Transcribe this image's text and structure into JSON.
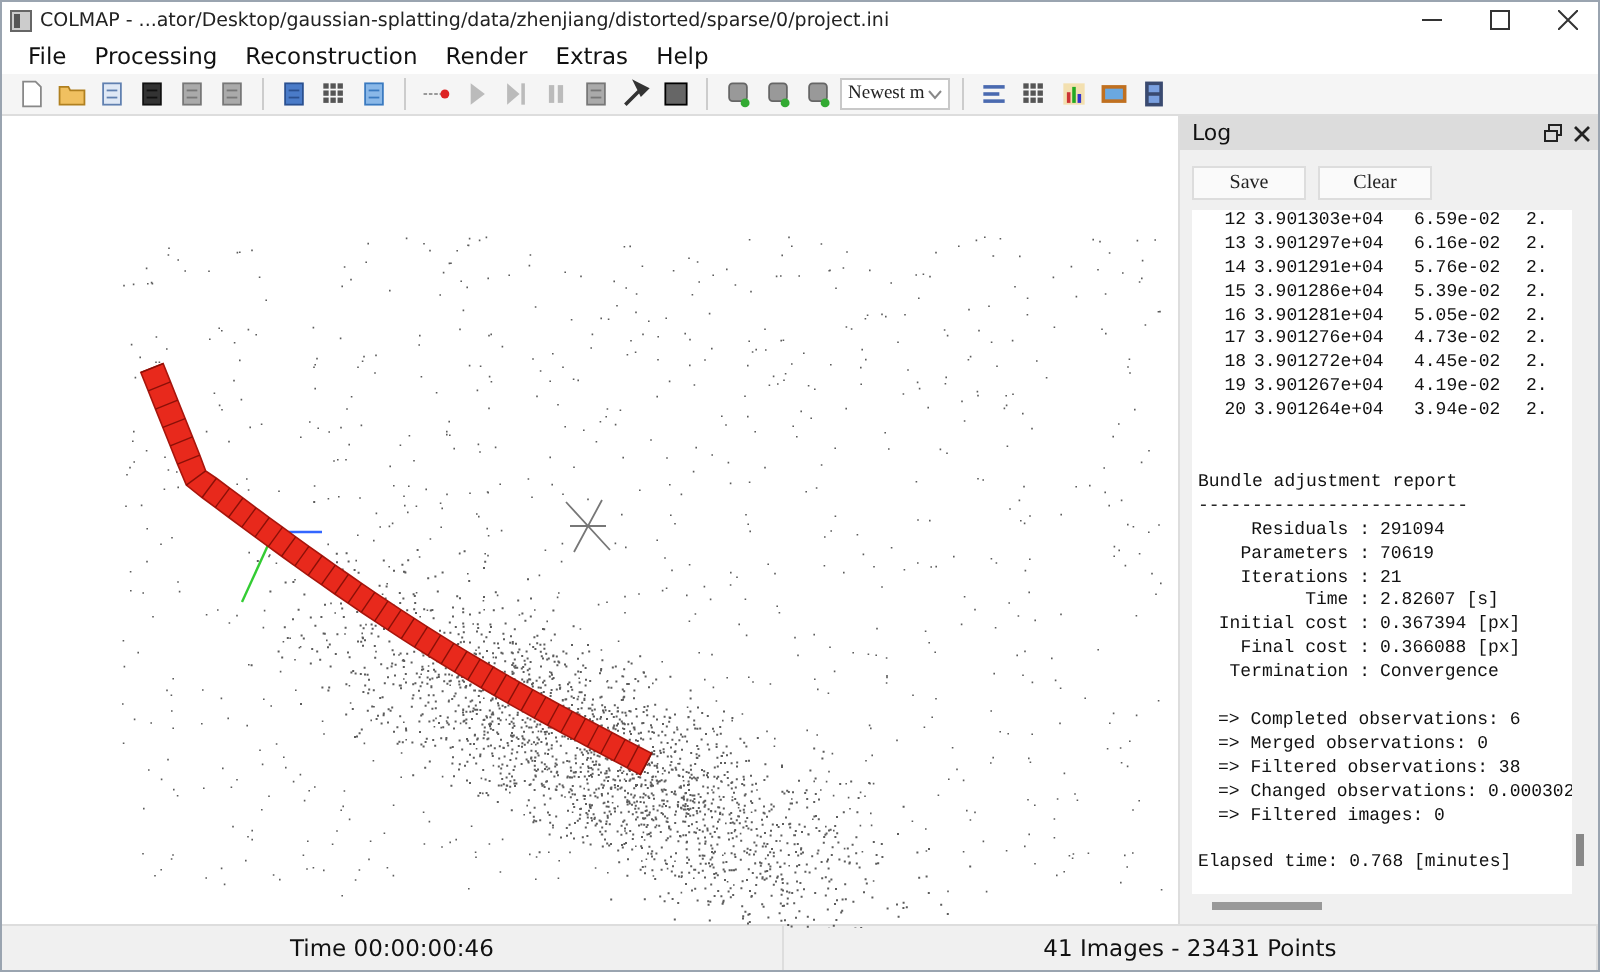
{
  "window": {
    "title": "COLMAP - ...ator/Desktop/gaussian-splatting/data/zhenjiang/distorted/sparse/0/project.ini"
  },
  "menu": [
    "File",
    "Processing",
    "Reconstruction",
    "Render",
    "Extras",
    "Help"
  ],
  "toolbar": {
    "combo_value": "Newest m"
  },
  "log": {
    "title": "Log",
    "buttons": [
      "Save",
      "Clear"
    ],
    "iterations": [
      {
        "cells": [
          "12",
          "3.901303e+04",
          "6.59e-02",
          "2."
        ]
      },
      {
        "cells": [
          "13",
          "3.901297e+04",
          "6.16e-02",
          "2."
        ]
      },
      {
        "cells": [
          "14",
          "3.901291e+04",
          "5.76e-02",
          "2."
        ]
      },
      {
        "cells": [
          "15",
          "3.901286e+04",
          "5.39e-02",
          "2."
        ]
      },
      {
        "cells": [
          "16",
          "3.901281e+04",
          "5.05e-02",
          "2."
        ]
      },
      {
        "cells": [
          "17",
          "3.901276e+04",
          "4.73e-02",
          "2."
        ]
      },
      {
        "cells": [
          "18",
          "3.901272e+04",
          "4.45e-02",
          "2."
        ]
      },
      {
        "cells": [
          "19",
          "3.901267e+04",
          "4.19e-02",
          "2."
        ]
      },
      {
        "cells": [
          "20",
          "3.901264e+04",
          "3.94e-02",
          "2."
        ]
      }
    ],
    "report_title": "Bundle adjustment report",
    "report_rule": "-------------------------",
    "report": [
      {
        "label": "Residuals :",
        "value": "291094"
      },
      {
        "label": "Parameters :",
        "value": "70619"
      },
      {
        "label": "Iterations :",
        "value": "21"
      },
      {
        "label": "Time :",
        "value": "2.82607 [s]"
      },
      {
        "label": "Initial cost :",
        "value": "0.367394 [px]"
      },
      {
        "label": "Final cost :",
        "value": "0.366088 [px]"
      },
      {
        "label": "Termination :",
        "value": "Convergence"
      }
    ],
    "notes": [
      "=> Completed observations: 6",
      "=> Merged observations: 0",
      "=> Filtered observations: 38",
      "=> Changed observations: 0.000302",
      "=> Filtered images: 0"
    ],
    "elapsed": "Elapsed time: 0.768 [minutes]"
  },
  "status_bar": {
    "time": "Time 00:00:00:46",
    "summary": "41 Images - 23431 Points"
  }
}
